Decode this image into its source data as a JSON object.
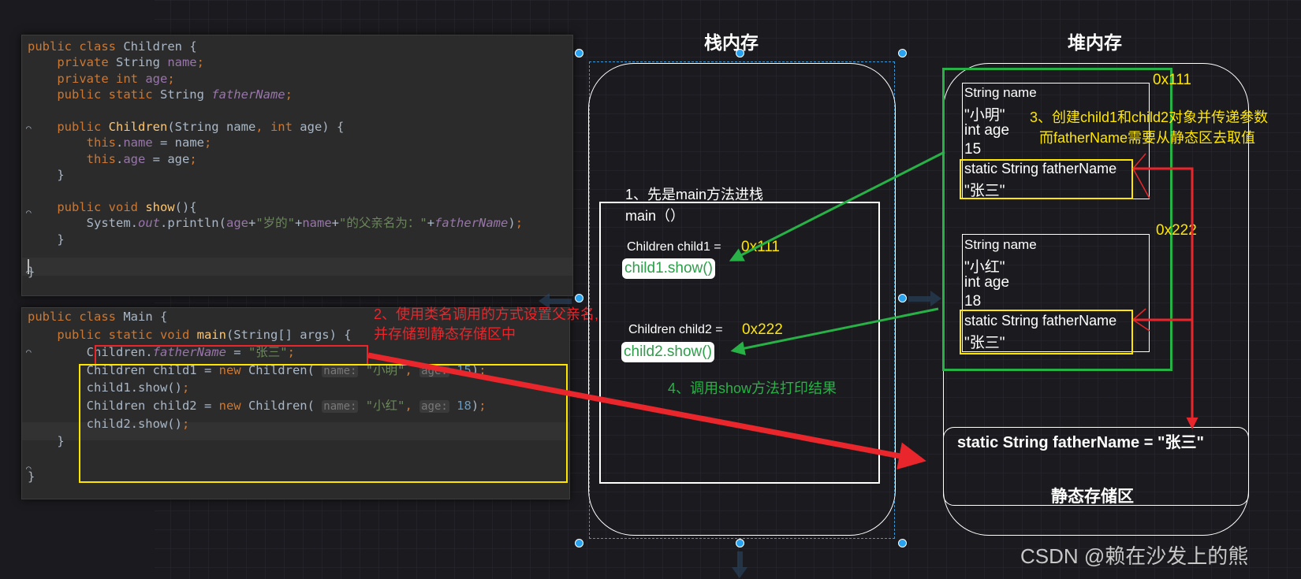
{
  "code1": {
    "lines": [
      [
        [
          "kw",
          "public class "
        ],
        [
          "pl",
          "Children {"
        ]
      ],
      [
        [
          "kw",
          "    private "
        ],
        [
          "pl",
          "String "
        ],
        [
          "fd",
          "name"
        ],
        [
          "kw",
          ";"
        ]
      ],
      [
        [
          "kw",
          "    private int "
        ],
        [
          "fd",
          "age"
        ],
        [
          "kw",
          ";"
        ]
      ],
      [
        [
          "kw",
          "    public static "
        ],
        [
          "pl",
          "String "
        ],
        [
          "it",
          "fatherName"
        ],
        [
          "kw",
          ";"
        ]
      ],
      [],
      [
        [
          "kw",
          "    public "
        ],
        [
          "fn",
          "Children"
        ],
        [
          "pl",
          "(String name"
        ],
        [
          "kw",
          ", int "
        ],
        [
          "pl",
          "age) {"
        ]
      ],
      [
        [
          "kw",
          "        this"
        ],
        [
          "pl",
          "."
        ],
        [
          "fd",
          "name"
        ],
        [
          "pl",
          " = name"
        ],
        [
          "kw",
          ";"
        ]
      ],
      [
        [
          "kw",
          "        this"
        ],
        [
          "pl",
          "."
        ],
        [
          "fd",
          "age"
        ],
        [
          "pl",
          " = age"
        ],
        [
          "kw",
          ";"
        ]
      ],
      [
        [
          "pl",
          "    }"
        ]
      ],
      [],
      [
        [
          "kw",
          "    public void "
        ],
        [
          "fn",
          "show"
        ],
        [
          "pl",
          "(){"
        ]
      ],
      [
        [
          "pl",
          "        System."
        ],
        [
          "it",
          "out"
        ],
        [
          "pl",
          ".println("
        ],
        [
          "fd",
          "age"
        ],
        [
          "pl",
          "+"
        ],
        [
          "st",
          "\"岁的\""
        ],
        [
          "pl",
          "+"
        ],
        [
          "fd",
          "name"
        ],
        [
          "pl",
          "+"
        ],
        [
          "st",
          "\"的父亲名为：\""
        ],
        [
          "pl",
          "+"
        ],
        [
          "it",
          "fatherName"
        ],
        [
          "pl",
          ")"
        ],
        [
          "kw",
          ";"
        ]
      ],
      [
        [
          "pl",
          "    }"
        ]
      ],
      [],
      [
        [
          "pl",
          "}"
        ]
      ]
    ]
  },
  "code2": {
    "lines": [
      [
        [
          "kw",
          "public class "
        ],
        [
          "pl",
          "Main {"
        ]
      ],
      [
        [
          "kw",
          "    public static void "
        ],
        [
          "fn",
          "main"
        ],
        [
          "pl",
          "(String[] args) {"
        ]
      ],
      [
        [
          "pl",
          "        Children."
        ],
        [
          "it",
          "fatherName"
        ],
        [
          "pl",
          " = "
        ],
        [
          "st",
          "\"张三\""
        ],
        [
          "kw",
          ";"
        ]
      ],
      [
        [
          "pl",
          "        Children child1 = "
        ],
        [
          "kw",
          "new "
        ],
        [
          "pl",
          "Children( "
        ],
        [
          "hint",
          "name:"
        ],
        [
          "st",
          " \"小明\""
        ],
        [
          "kw",
          ", "
        ],
        [
          "hint",
          "age:"
        ],
        [
          "nm",
          " 15"
        ],
        [
          "pl",
          ")"
        ],
        [
          "kw",
          ";"
        ]
      ],
      [
        [
          "pl",
          "        child1.show()"
        ],
        [
          "kw",
          ";"
        ]
      ],
      [
        [
          "pl",
          "        Children child2 = "
        ],
        [
          "kw",
          "new "
        ],
        [
          "pl",
          "Children( "
        ],
        [
          "hint",
          "name:"
        ],
        [
          "st",
          " \"小红\""
        ],
        [
          "kw",
          ", "
        ],
        [
          "hint",
          "age:"
        ],
        [
          "nm",
          " 18"
        ],
        [
          "pl",
          ")"
        ],
        [
          "kw",
          ";"
        ]
      ],
      [
        [
          "pl",
          "        child2.show()"
        ],
        [
          "kw",
          ";"
        ]
      ],
      [
        [
          "pl",
          "    }"
        ]
      ],
      [],
      [
        [
          "pl",
          "}"
        ]
      ]
    ]
  },
  "stack": {
    "title": "栈内存",
    "step1": "1、先是main方法进栈",
    "frame": "main（）",
    "child1": "Children child1 =",
    "addr1": "0x111",
    "call1": "child1.show()",
    "child2": "Children child2 =",
    "addr2": "0x222",
    "call2": "child2.show()",
    "step4": "4、调用show方法打印结果"
  },
  "heap": {
    "title": "堆内存",
    "obj1": {
      "addr": "0x111",
      "l1": "String name",
      "l2": "\"小明\"",
      "l3": "int age",
      "l4": "15",
      "s1": "static String fatherName",
      "s2": "\"张三\""
    },
    "obj2": {
      "addr": "0x222",
      "l1": "String name",
      "l2": "\"小红\"",
      "l3": "int age",
      "l4": "18",
      "s1": "static String fatherName",
      "s2": "\"张三\""
    },
    "note1": "3、创建child1和child2对象并传递参数",
    "note2": "而fatherName需要从静态区去取值",
    "static_value": "static String fatherName = \"张三\"",
    "static_label": "静态存储区"
  },
  "annotation2": {
    "l1": "2、使用类名调用的方式设置父亲名,",
    "l2": "并存储到静态存储区中"
  },
  "watermark": "CSDN @赖在沙发上的熊",
  "colors": {
    "red": "#e8262b",
    "green": "#28b146",
    "yellow": "#ffe600",
    "addr": "#ffe600",
    "annotation": "#e8262b",
    "handle": "#29a3f0"
  }
}
